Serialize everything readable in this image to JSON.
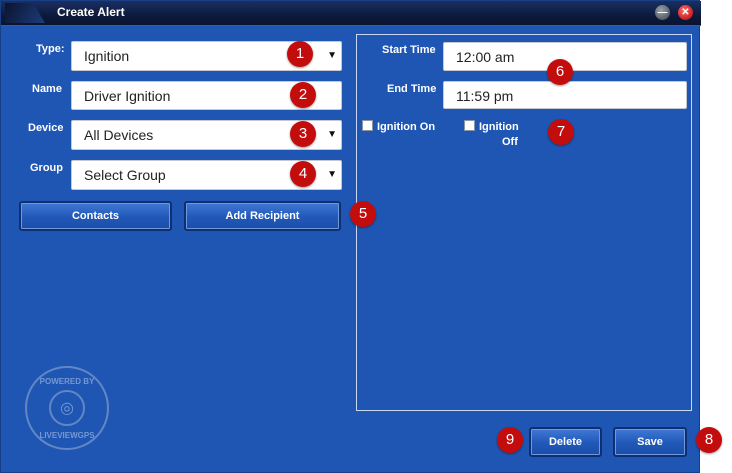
{
  "window": {
    "title": "Create Alert"
  },
  "form": {
    "type_label": "Type:",
    "type_value": "Ignition",
    "name_label": "Name",
    "name_value": "Driver Ignition",
    "device_label": "Device",
    "device_value": "All Devices",
    "group_label": "Group",
    "group_value": "Select Group"
  },
  "buttons": {
    "contacts": "Contacts",
    "add_recipient": "Add Recipient",
    "delete": "Delete",
    "save": "Save"
  },
  "schedule": {
    "start_label": "Start Time",
    "start_value": "12:00 am",
    "end_label": "End Time",
    "end_value": "11:59 pm",
    "ignition_on_label": "Ignition On",
    "ignition_off_line1": "Ignition",
    "ignition_off_line2": "Off"
  },
  "badges": [
    "1",
    "2",
    "3",
    "4",
    "5",
    "6",
    "7",
    "8",
    "9"
  ],
  "logo": {
    "top_text": "POWERED BY",
    "bottom_text": "LIVEVIEWGPS"
  },
  "icons": {
    "minimize": "minimize-icon",
    "close": "close-icon",
    "dropdown": "chevron-down-icon"
  },
  "colors": {
    "window_bg": "#1f56b3",
    "badge": "#c30d0d"
  }
}
